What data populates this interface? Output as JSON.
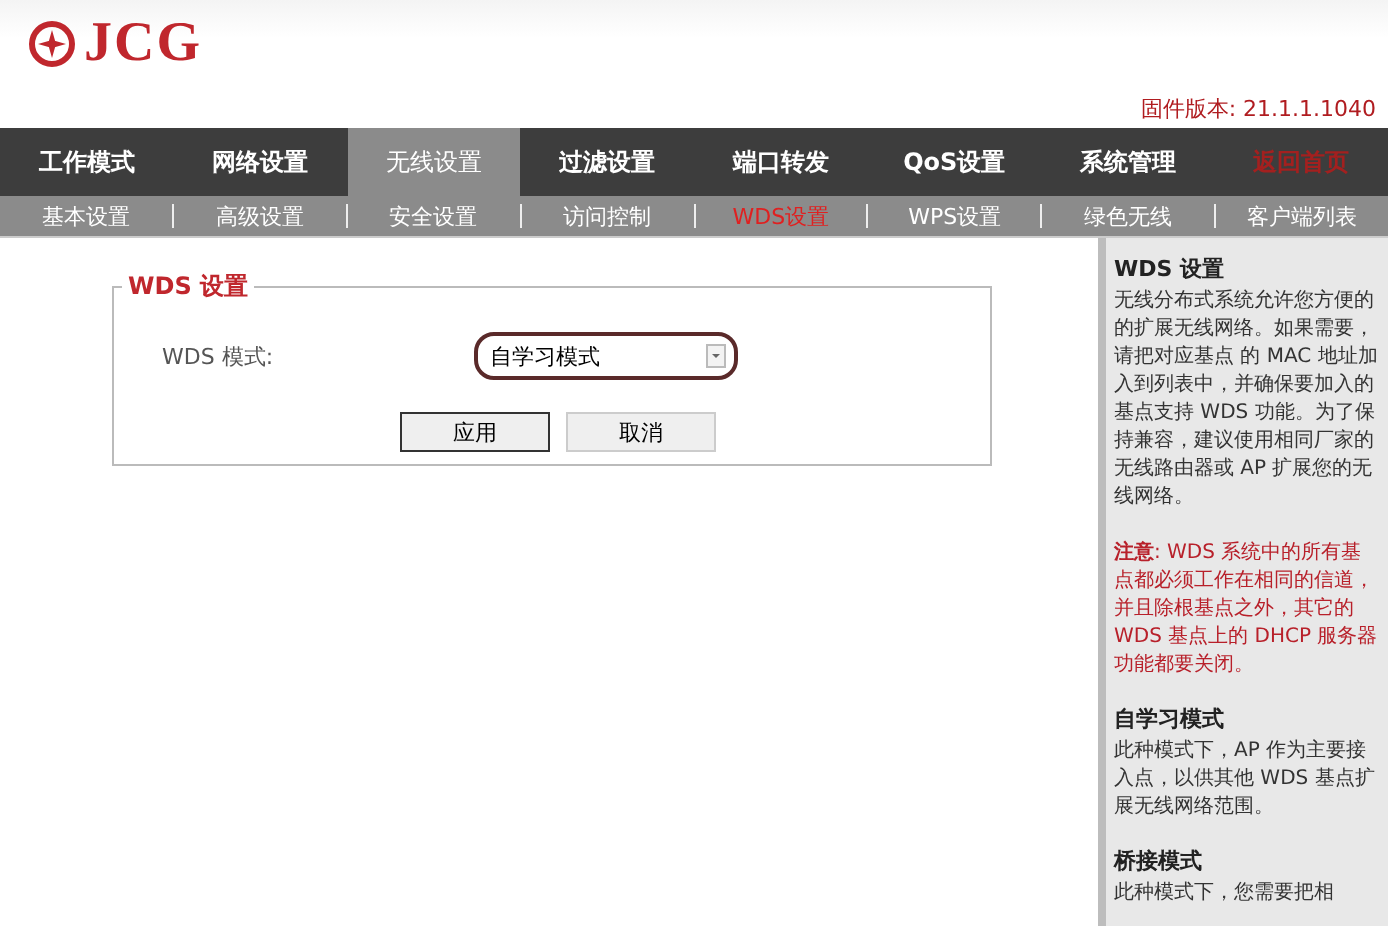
{
  "brand": {
    "name": "JCG"
  },
  "firmware": "固件版本: 21.1.1.1040",
  "main_nav": [
    {
      "label": "工作模式",
      "selected": false,
      "kind": "tab"
    },
    {
      "label": "网络设置",
      "selected": false,
      "kind": "tab"
    },
    {
      "label": "无线设置",
      "selected": true,
      "kind": "tab"
    },
    {
      "label": "过滤设置",
      "selected": false,
      "kind": "tab"
    },
    {
      "label": "端口转发",
      "selected": false,
      "kind": "tab"
    },
    {
      "label": "QoS设置",
      "selected": false,
      "kind": "tab"
    },
    {
      "label": "系统管理",
      "selected": false,
      "kind": "tab"
    },
    {
      "label": "返回首页",
      "selected": false,
      "kind": "link"
    }
  ],
  "sub_nav": [
    {
      "label": "基本设置",
      "selected": false
    },
    {
      "label": "高级设置",
      "selected": false
    },
    {
      "label": "安全设置",
      "selected": false
    },
    {
      "label": "访问控制",
      "selected": false
    },
    {
      "label": "WDS设置",
      "selected": true
    },
    {
      "label": "WPS设置",
      "selected": false
    },
    {
      "label": "绿色无线",
      "selected": false
    },
    {
      "label": "客户端列表",
      "selected": false
    }
  ],
  "panel": {
    "legend": "WDS 设置",
    "field_label": "WDS 模式:",
    "select_value": "自学习模式",
    "buttons": [
      "应用",
      "取消"
    ]
  },
  "help": [
    {
      "kind": "title",
      "text": "WDS 设置"
    },
    {
      "kind": "body",
      "text": "无线分布式系统允许您方便的的扩展无线网络。如果需要，请把对应基点 的 MAC 地址加入到列表中，并确保要加入的基点支持 WDS 功能。为了保持兼容，建议使用相同厂家的无线路由器或 AP 扩展您的无线网络。"
    },
    {
      "kind": "note",
      "text": "**注意**: WDS 系统中的所有基点都必须工作在相同的信道，并且除根基点之外，其它的 WDS 基点上的 DHCP 服务器功能都要关闭。"
    },
    {
      "kind": "title",
      "text": "自学习模式"
    },
    {
      "kind": "body",
      "text": "此种模式下，AP 作为主要接入点，以供其他 WDS 基点扩展无线网络范围。"
    },
    {
      "kind": "title",
      "text": "桥接模式"
    },
    {
      "kind": "body",
      "text": "此种模式下，您需要把相"
    }
  ]
}
